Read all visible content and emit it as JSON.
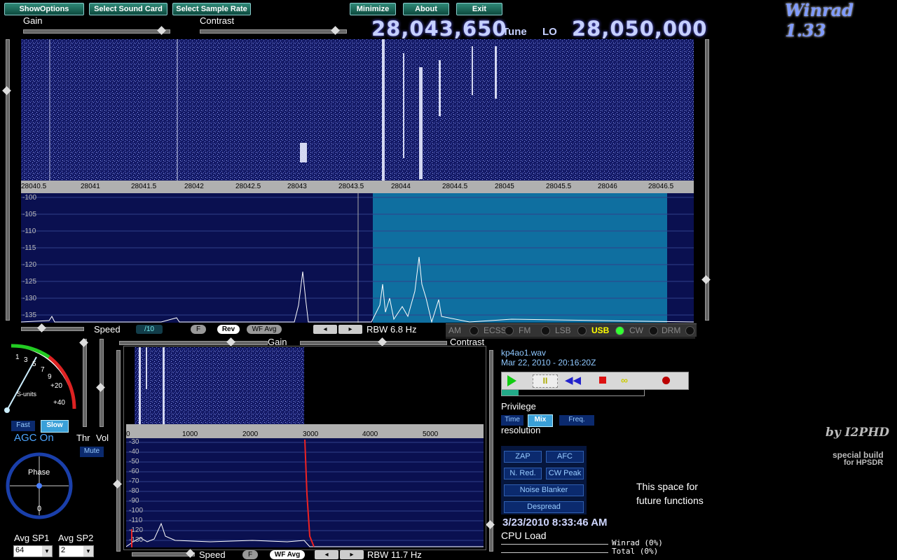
{
  "app_title": "Winrad 1.33",
  "toolbar": {
    "show_options": "ShowOptions",
    "select_sound_card": "Select Sound Card",
    "select_sample_rate": "Select Sample Rate",
    "minimize": "Minimize",
    "about": "About",
    "exit": "Exit"
  },
  "top_sliders": {
    "gain": "Gain",
    "contrast": "Contrast",
    "gain_level": 0.93,
    "contrast_level": 0.98
  },
  "tuning": {
    "tune_freq": "28,043,650",
    "tune_label": "Tune",
    "lo_label": "LO",
    "lo_freq": "28,050,000"
  },
  "freq_axis": [
    "28040.5",
    "28041",
    "28041.5",
    "28042",
    "28042.5",
    "28043",
    "28043.5",
    "28044",
    "28044.5",
    "28045",
    "28045.5",
    "28046",
    "28046.5"
  ],
  "db_axis": [
    "-100",
    "-105",
    "-110",
    "-115",
    "-120",
    "-125",
    "-130",
    "-135"
  ],
  "controls_row": {
    "speed": "Speed",
    "speed_div": "/10",
    "f": "F",
    "rev": "Rev",
    "wf_avg": "WF Avg",
    "rbw": "RBW  6.8 Hz"
  },
  "modes": [
    {
      "label": "AM",
      "active": false
    },
    {
      "label": "ECSS",
      "active": false
    },
    {
      "label": "FM",
      "active": false
    },
    {
      "label": "LSB",
      "active": false
    },
    {
      "label": "USB",
      "active": true
    },
    {
      "label": "CW",
      "active": false
    },
    {
      "label": "DRM",
      "active": false
    }
  ],
  "smeter": {
    "scale": [
      "1",
      "3",
      "5",
      "7",
      "9",
      "+20",
      "+40"
    ],
    "units": "S-units",
    "fast": "Fast",
    "slow": "Slow",
    "agc": "AGC On",
    "thr": "Thr",
    "vol": "Vol",
    "mute": "Mute"
  },
  "phase": {
    "label": "Phase",
    "zero": "0"
  },
  "avg": {
    "sp1_label": "Avg SP1",
    "sp2_label": "Avg SP2",
    "sp1_value": "64",
    "sp2_value": "2"
  },
  "lower_panel": {
    "gain": "Gain",
    "contrast": "Contrast",
    "freq_axis": [
      "0",
      "1000",
      "2000",
      "3000",
      "4000",
      "5000"
    ],
    "db_axis": [
      "-30",
      "-40",
      "-50",
      "-60",
      "-70",
      "-80",
      "-90",
      "-100",
      "-110",
      "-120",
      "-130"
    ],
    "speed": "Speed",
    "f": "F",
    "wf_avg": "WF Avg",
    "rbw": "RBW 11.7 Hz"
  },
  "file": {
    "name": "kp4ao1.wav",
    "date": "Mar 22, 2010 - 20:16:20Z"
  },
  "privilege": {
    "title": "Privilege",
    "time": "Time",
    "mix": "Mix",
    "freq": "Freq.",
    "resolution": "resolution"
  },
  "dsp": {
    "zap": "ZAP",
    "afc": "AFC",
    "nred": "N. Red.",
    "cwpeak": "CW Peak",
    "nb": "Noise Blanker",
    "despread": "Despread"
  },
  "future": {
    "line1": "This space for",
    "line2": "future functions"
  },
  "credits": {
    "by": "by I2PHD",
    "special": "special build",
    "for": "for HPSDR"
  },
  "clock": "3/23/2010 8:33:46 AM",
  "cpu": {
    "label": "CPU Load",
    "winrad": "Winrad (0%)",
    "total": "Total  (0%)"
  },
  "colors": {
    "accent": "#2f8a78",
    "passband": "#0f6fa0",
    "spectrum_bg": "#0a1050"
  }
}
